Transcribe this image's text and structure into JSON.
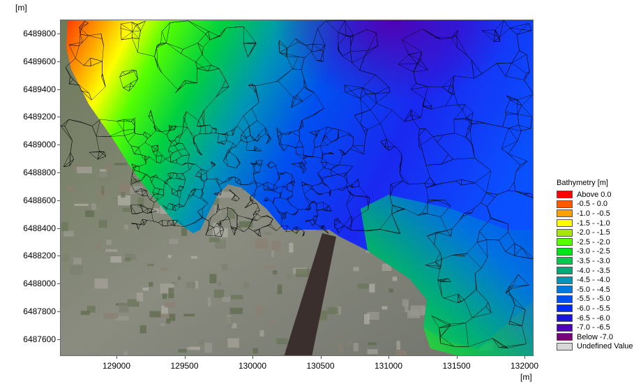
{
  "axes": {
    "y_unit": "[m]",
    "x_unit": "[m]",
    "y_ticks": [
      "6489800",
      "6489600",
      "6489400",
      "6489200",
      "6489000",
      "6488800",
      "6488600",
      "6488400",
      "6488200",
      "6488000",
      "6487800",
      "6487600"
    ],
    "x_ticks": [
      "129000",
      "129500",
      "130000",
      "130500",
      "131000",
      "131500",
      "132000"
    ]
  },
  "legend": {
    "title": "Bathymetry [m]",
    "items": [
      {
        "label": "Above  0.0",
        "color": "#ff0000"
      },
      {
        "label": "-0.5 -  0.0",
        "color": "#ff5a00"
      },
      {
        "label": "-1.0 - -0.5",
        "color": "#ffa000"
      },
      {
        "label": "-1.5 - -1.0",
        "color": "#ffff00"
      },
      {
        "label": "-2.0 - -1.5",
        "color": "#a8e600"
      },
      {
        "label": "-2.5 - -2.0",
        "color": "#55ff00"
      },
      {
        "label": "-3.0 - -2.5",
        "color": "#00e61a"
      },
      {
        "label": "-3.5 - -3.0",
        "color": "#00c850"
      },
      {
        "label": "-4.0 - -3.5",
        "color": "#00aa78"
      },
      {
        "label": "-4.5 - -4.0",
        "color": "#0096b4"
      },
      {
        "label": "-5.0 - -4.5",
        "color": "#0078dc"
      },
      {
        "label": "-5.5 - -5.0",
        "color": "#0050f0"
      },
      {
        "label": "-6.0 - -5.5",
        "color": "#0028ff"
      },
      {
        "label": "-6.5 - -6.0",
        "color": "#1a14dc"
      },
      {
        "label": "-7.0 - -6.5",
        "color": "#5000b4"
      },
      {
        "label": "Below -7.0",
        "color": "#7a0078"
      },
      {
        "label": "Undefined Value",
        "color": "#d8d8d8"
      }
    ]
  }
}
